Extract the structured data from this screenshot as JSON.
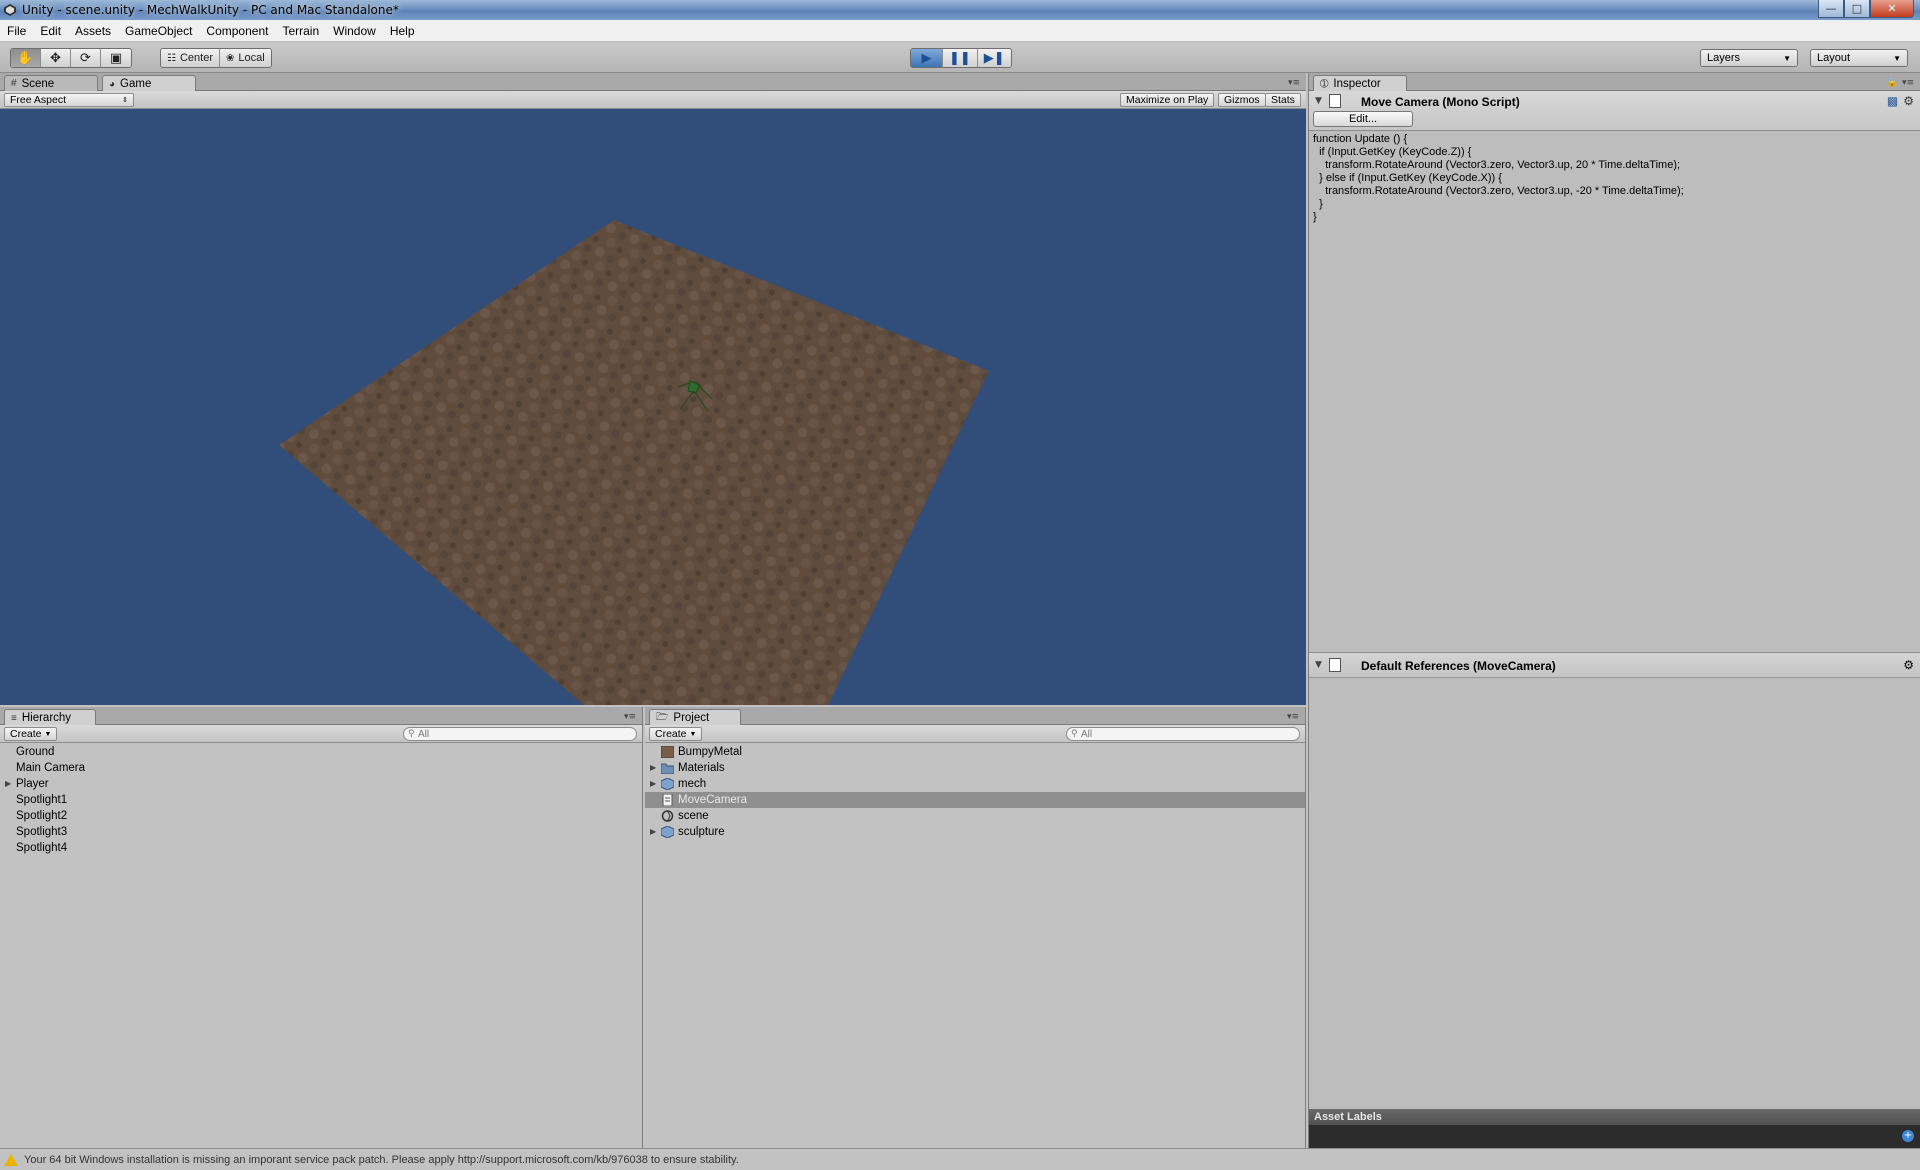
{
  "window": {
    "title": "Unity - scene.unity - MechWalkUnity - PC and Mac Standalone*"
  },
  "menu": [
    "File",
    "Edit",
    "Assets",
    "GameObject",
    "Component",
    "Terrain",
    "Window",
    "Help"
  ],
  "toolbar": {
    "pivot_label": "Center",
    "space_label": "Local",
    "layers_label": "Layers",
    "layout_label": "Layout"
  },
  "game_panel": {
    "tabs": [
      "Scene",
      "Game"
    ],
    "aspect": "Free Aspect",
    "maximize": "Maximize on Play",
    "gizmos": "Gizmos",
    "stats": "Stats",
    "sky_color": "#314d7a",
    "ground_color": "#5f4c3d"
  },
  "inspector": {
    "tab": "Inspector",
    "script_title": "Move Camera (Mono Script)",
    "edit_label": "Edit...",
    "code": "function Update () {\n  if (Input.GetKey (KeyCode.Z)) {\n    transform.RotateAround (Vector3.zero, Vector3.up, 20 * Time.deltaTime);\n  } else if (Input.GetKey (KeyCode.X)) {\n    transform.RotateAround (Vector3.zero, Vector3.up, -20 * Time.deltaTime);\n  }\n}",
    "default_refs": "Default References (MoveCamera)",
    "asset_labels": "Asset Labels"
  },
  "hierarchy": {
    "tab": "Hierarchy",
    "create": "Create",
    "search": "All",
    "items": [
      {
        "label": "Ground",
        "expandable": false
      },
      {
        "label": "Main Camera",
        "expandable": false
      },
      {
        "label": "Player",
        "expandable": true
      },
      {
        "label": "Spotlight1",
        "expandable": false
      },
      {
        "label": "Spotlight2",
        "expandable": false
      },
      {
        "label": "Spotlight3",
        "expandable": false
      },
      {
        "label": "Spotlight4",
        "expandable": false
      }
    ]
  },
  "project": {
    "tab": "Project",
    "create": "Create",
    "search": "All",
    "items": [
      {
        "label": "BumpyMetal",
        "icon": "material-icon",
        "expandable": false
      },
      {
        "label": "Materials",
        "icon": "folder-icon",
        "expandable": true
      },
      {
        "label": "mech",
        "icon": "model-icon",
        "expandable": true
      },
      {
        "label": "MoveCamera",
        "icon": "script-icon",
        "expandable": false,
        "selected": true
      },
      {
        "label": "scene",
        "icon": "scene-icon",
        "expandable": false
      },
      {
        "label": "sculpture",
        "icon": "model-icon",
        "expandable": true
      }
    ]
  },
  "status": {
    "message": "Your 64 bit Windows installation is missing an imporant service pack patch. Please apply http://support.microsoft.com/kb/976038 to ensure stability."
  }
}
